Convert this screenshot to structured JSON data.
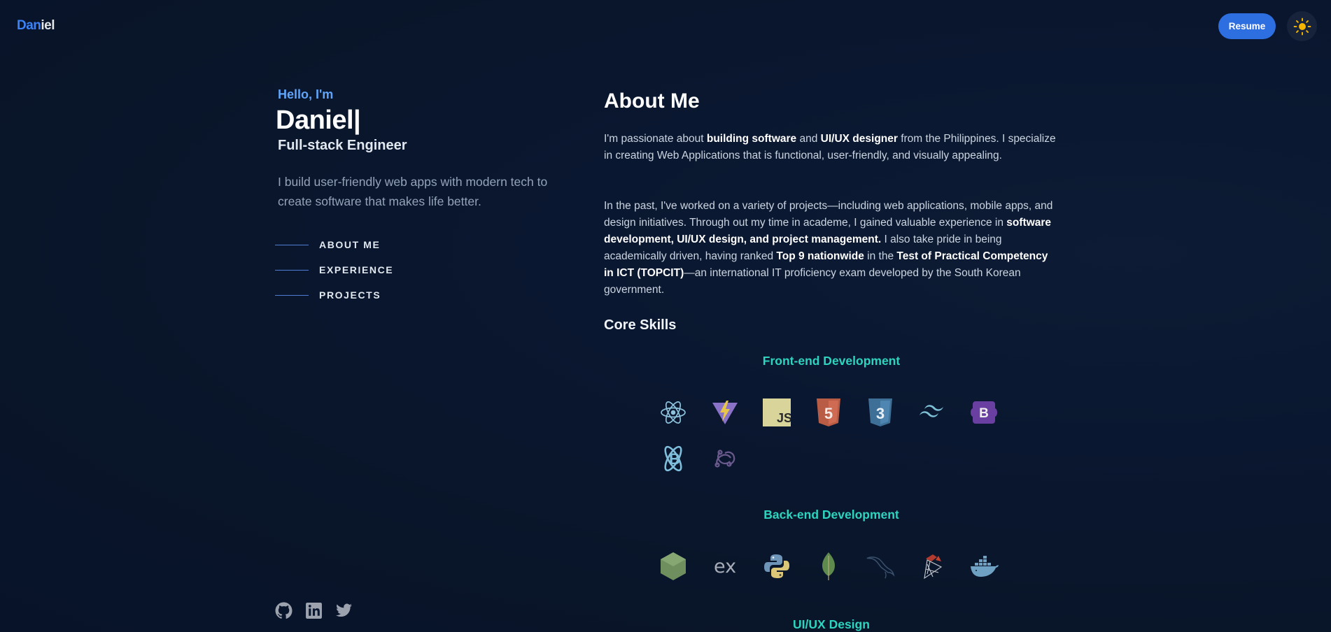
{
  "header": {
    "logo_part1": "Dan",
    "logo_part2": "iel",
    "resume_label": "Resume",
    "theme_icon": "sun-icon"
  },
  "hero": {
    "greeting": "Hello, I'm",
    "name": "Daniel|",
    "role": "Full-stack Engineer",
    "tagline": "I build user-friendly web apps with modern tech to create software that makes life better."
  },
  "nav": {
    "items": [
      {
        "label": "ABOUT ME"
      },
      {
        "label": "EXPERIENCE"
      },
      {
        "label": "PROJECTS"
      }
    ]
  },
  "socials": [
    "github-icon",
    "linkedin-icon",
    "twitter-icon"
  ],
  "about": {
    "title": "About Me",
    "p1": {
      "t1": "I'm passionate about ",
      "b1": "building software",
      "t2": " and ",
      "b2": "UI/UX designer",
      "t3": " from the Philippines. I specialize in creating Web Applications that is functional, user-friendly, and visually appealing."
    },
    "p2": {
      "t1": "In the past, I've worked on a variety of projects—including web applications, mobile apps, and design initiatives. Through out my time in academe, I gained valuable experience in ",
      "b1": "software development, UI/UX design, and project management.",
      "t2": " I also take pride in being academically driven, having ranked ",
      "b2": "Top 9 nationwide",
      "t3": " in the ",
      "b3": "Test of Practical Competency in ICT (TOPCIT)",
      "t4": "—an international IT proficiency exam developed by the South Korean government."
    }
  },
  "skills": {
    "title": "Core Skills",
    "categories": [
      {
        "label": "Front-end Development",
        "icons": [
          "react-icon",
          "vite-icon",
          "javascript-icon",
          "html5-icon",
          "css3-icon",
          "tailwind-icon",
          "bootstrap-icon",
          "react-bootstrap-icon",
          "redux-icon"
        ]
      },
      {
        "label": "Back-end Development",
        "icons": [
          "nodejs-icon",
          "express-icon",
          "python-icon",
          "mongodb-icon",
          "mysql-icon",
          "scikit-learn-icon",
          "docker-icon"
        ]
      },
      {
        "label": "UI/UX Design",
        "icons": []
      }
    ]
  }
}
